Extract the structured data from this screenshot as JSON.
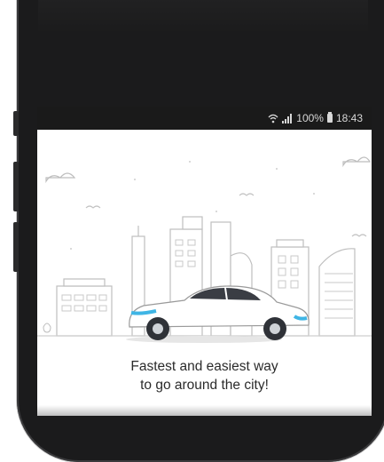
{
  "status_bar": {
    "wifi_icon": "wifi-icon",
    "signal_icon": "signal-icon",
    "battery_percent": "100%",
    "battery_icon": "battery-icon",
    "time": "18:43"
  },
  "illustration": {
    "subject": "city-skyline-with-taxi",
    "car_color": "#ffffff",
    "accent_color": "#3fb5e5"
  },
  "onboarding": {
    "line1": "Fastest and easiest way",
    "line2": "to go around the city!"
  },
  "colors": {
    "device_body": "#1b1b1c",
    "status_bar_bg": "#1a1a1a",
    "status_text": "#d7d7d7",
    "sketch_line": "#b8b8b8"
  }
}
